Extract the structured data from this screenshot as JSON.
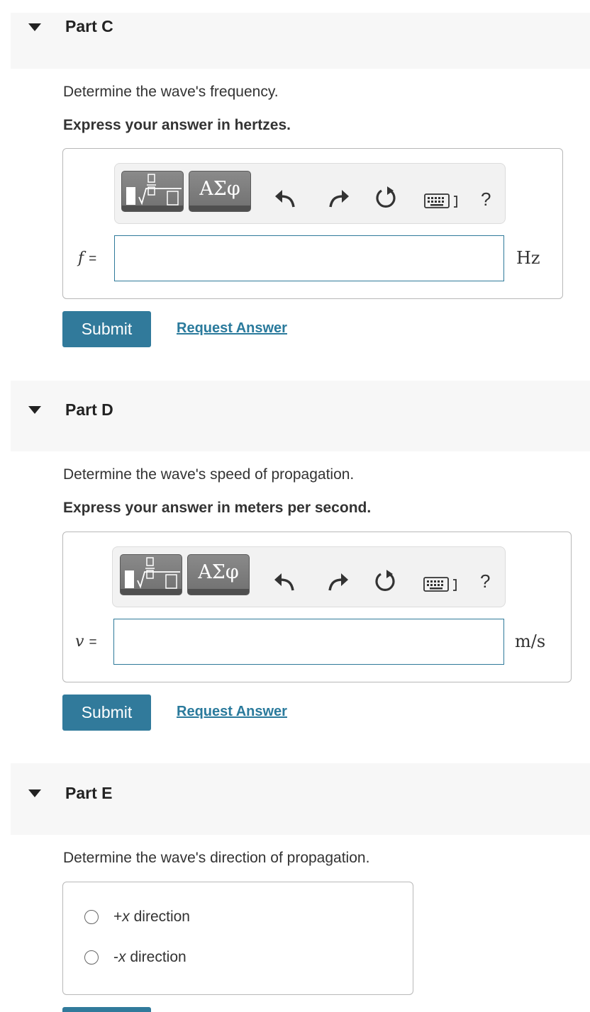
{
  "partC": {
    "title": "Part C",
    "question": "Determine the wave's frequency.",
    "instruction": "Express your answer in hertzes.",
    "greek_label": "ΑΣφ",
    "help_label": "?",
    "variable": "f",
    "equals": "=",
    "unit": "Hz",
    "input_value": "",
    "submit_label": "Submit",
    "request_label": "Request Answer"
  },
  "partD": {
    "title": "Part D",
    "question": "Determine the wave's speed of propagation.",
    "instruction": "Express your answer in meters per second.",
    "greek_label": "ΑΣφ",
    "help_label": "?",
    "variable": "v",
    "equals": "=",
    "unit": "m/s",
    "input_value": "",
    "submit_label": "Submit",
    "request_label": "Request Answer"
  },
  "partE": {
    "title": "Part E",
    "question": "Determine the wave's direction of propagation.",
    "options": [
      {
        "sign": "+",
        "var": "x",
        "text": " direction"
      },
      {
        "sign": "-",
        "var": "x",
        "text": " direction"
      }
    ]
  },
  "colors": {
    "accent": "#317a9b",
    "link": "#2a7a9c",
    "header_bg": "#f7f7f7"
  },
  "icons": [
    "expand-caret-icon",
    "template-icon",
    "undo-icon",
    "redo-icon",
    "reset-icon",
    "keyboard-icon",
    "help-icon"
  ]
}
